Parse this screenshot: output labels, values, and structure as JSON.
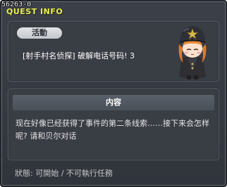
{
  "header": {
    "quest_id": "56263-0",
    "title": "QUEST INFO"
  },
  "quest": {
    "category_label": "活動",
    "name": "[射手村名侦探] 破解电话号码! 3",
    "npc_icon": "police-girl-npc-icon"
  },
  "content": {
    "header_label": "内容",
    "text": "现在好像已经获得了事件的第二条线索……接下来会怎样呢? 请和贝尔对话"
  },
  "footer": {
    "status": "狀態: 可開始 / 不可執行任務"
  },
  "colors": {
    "title": "#e8ef4a",
    "window_bg": "#3a3e45",
    "panel_bg": "#393d44",
    "pill_bg": "#d6d8dc",
    "content_header_bg": "#525860"
  }
}
